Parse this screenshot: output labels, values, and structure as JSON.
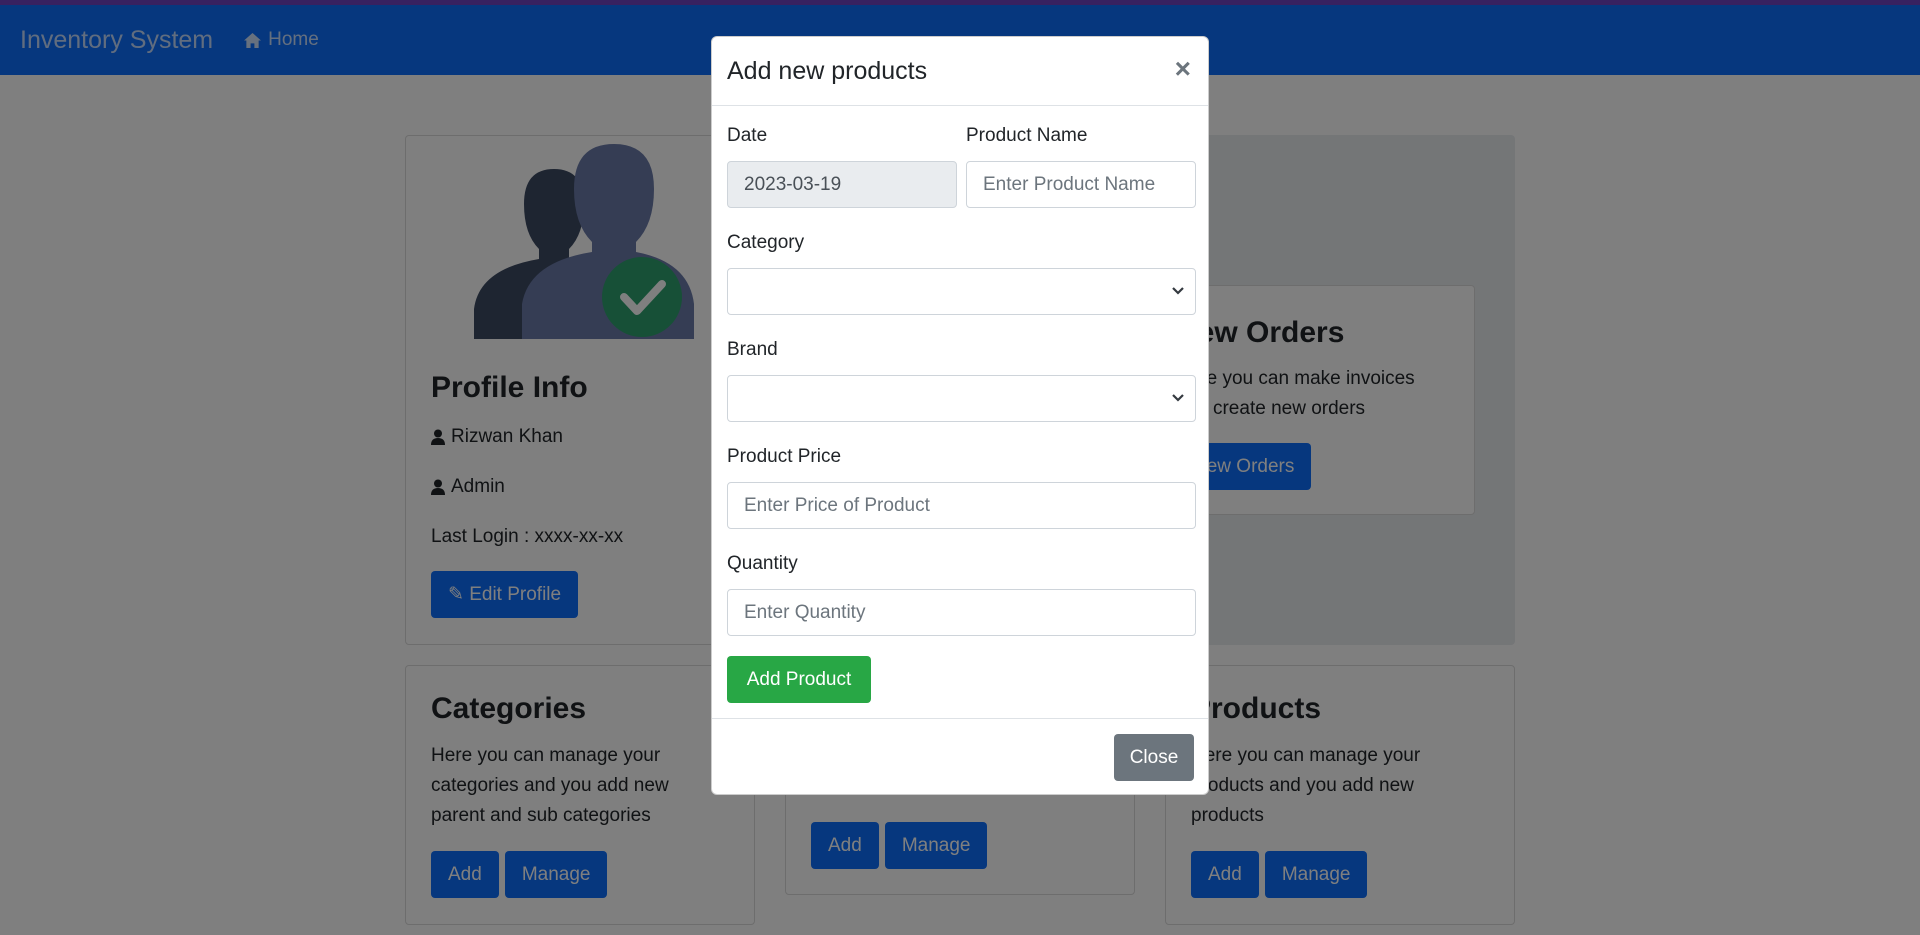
{
  "navbar": {
    "brand": "Inventory System",
    "home_label": "Home",
    "home_icon": "home-icon",
    "accent": "#0d6efd"
  },
  "profile": {
    "title": "Profile Info",
    "name": "Rizwan Khan",
    "role": "Admin",
    "last_login": "Last Login : xxxx-xx-xx",
    "edit_label": "Edit Profile"
  },
  "orders": {
    "title": "New Orders",
    "desc_1": "Here you can make invoices",
    "desc_2": "and create new orders",
    "button_label": "New Orders"
  },
  "categories": {
    "title": "Categories",
    "desc_1": "Here you can manage your",
    "desc_2": "categories and you add new",
    "desc_3": "parent and sub categories",
    "add_label": "Add",
    "manage_label": "Manage"
  },
  "brands": {
    "add_label": "Add",
    "manage_label": "Manage"
  },
  "products": {
    "title": "Products",
    "desc_1": "Here you can manage your",
    "desc_2": "products and you add new",
    "desc_3": "products",
    "add_label": "Add",
    "manage_label": "Manage"
  },
  "modal": {
    "title": "Add new products",
    "close_symbol": "×",
    "date_label": "Date",
    "date_value": "2023-03-19",
    "product_name_label": "Product Name",
    "product_name_placeholder": "Enter Product Name",
    "category_label": "Category",
    "brand_label": "Brand",
    "price_label": "Product Price",
    "price_placeholder": "Enter Price of Product",
    "quantity_label": "Quantity",
    "quantity_placeholder": "Enter Quantity",
    "submit_label": "Add Product",
    "close_label": "Close"
  }
}
